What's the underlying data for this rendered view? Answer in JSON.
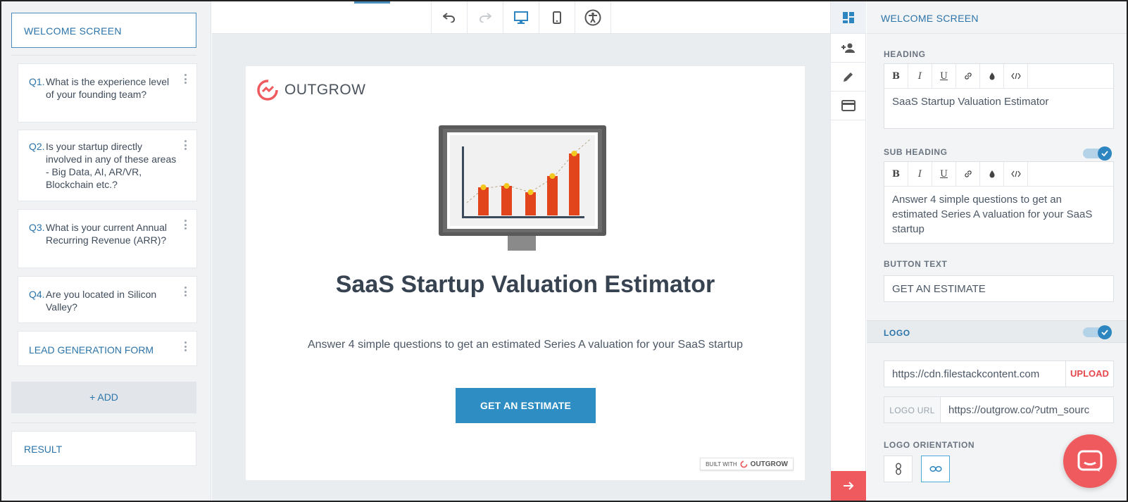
{
  "sidebar": {
    "welcome_label": "WELCOME SCREEN",
    "questions": [
      {
        "num": "Q1.",
        "text": "What is the experience level of your founding team?"
      },
      {
        "num": "Q2.",
        "text": "Is your startup directly involved in any of these areas - Big Data, AI, AR/VR, Blockchain etc.?"
      },
      {
        "num": "Q3.",
        "text": "What is your current Annual Recurring Revenue (ARR)?"
      },
      {
        "num": "Q4.",
        "text": "Are you located in Silicon Valley?"
      }
    ],
    "lead_form_label": "LEAD GENERATION FORM",
    "add_label": "+ ADD",
    "result_label": "RESULT"
  },
  "toolbar": {
    "icons": [
      "undo-icon",
      "redo-icon",
      "desktop-icon",
      "mobile-icon",
      "accessibility-icon"
    ],
    "active_view": "desktop"
  },
  "preview": {
    "logo_text": "OUTGROW",
    "title": "SaaS Startup Valuation Estimator",
    "subtitle": "Answer 4 simple questions to get an estimated Series A valuation for your SaaS startup",
    "button_label": "GET AN ESTIMATE",
    "built_with_prefix": "BUILT WITH",
    "built_with_brand": "OUTGROW",
    "accent_color": "#2e8dc3"
  },
  "rail": {
    "icons": [
      "layout-icon",
      "add-user-icon",
      "pencil-icon",
      "card-icon"
    ],
    "bottom_icon": "arrow-right-icon"
  },
  "panel": {
    "header": "WELCOME SCREEN",
    "heading_label": "HEADING",
    "heading_value": "SaaS Startup Valuation Estimator",
    "subheading_label": "SUB HEADING",
    "subheading_enabled": true,
    "subheading_value": "Answer 4 simple questions to get an estimated Series A valuation for your SaaS startup",
    "button_text_label": "BUTTON TEXT",
    "button_text_value": "GET AN ESTIMATE",
    "logo_label": "LOGO",
    "logo_enabled": true,
    "logo_image_url": "https://cdn.filestackcontent.com",
    "upload_label": "UPLOAD",
    "logo_url_label": "LOGO URL",
    "logo_url_value": "https://outgrow.co/?utm_sourc",
    "orientation_label": "LOGO ORIENTATION",
    "editor_tools": [
      "B",
      "I",
      "U",
      "link-icon",
      "drop-icon",
      "code-icon"
    ]
  },
  "colors": {
    "brand_blue": "#2c74a9",
    "brand_red": "#ee5a5e"
  }
}
